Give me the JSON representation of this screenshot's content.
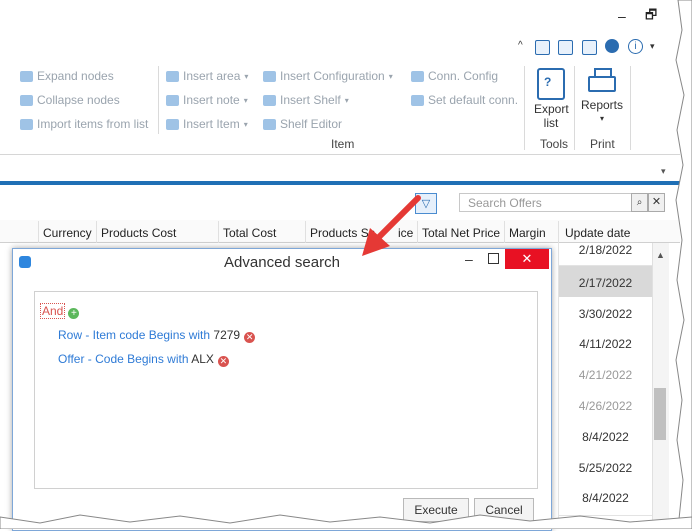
{
  "window": {
    "minimize": "–",
    "restore": "🗗"
  },
  "ribbon": {
    "nodes": [
      "Expand nodes",
      "Collapse nodes",
      "Import items from list"
    ],
    "insert": [
      "Insert area",
      "Insert note",
      "Insert Item"
    ],
    "config": [
      "Insert Configuration",
      "Insert Shelf",
      "Shelf Editor"
    ],
    "conn": [
      "Conn. Config",
      "Set default conn."
    ],
    "item_group": "Item",
    "export_label": "Export list",
    "tools_group": "Tools",
    "reports_label": "Reports",
    "print_group": "Print"
  },
  "search": {
    "placeholder": "Search Offers"
  },
  "grid": {
    "headers": [
      "Currency",
      "Products Cost",
      "Total Cost",
      "Products Sa",
      "ice",
      "Total Net Price",
      "Margin",
      "Update date"
    ],
    "dates": [
      "2/18/2022",
      "2/17/2022",
      "3/30/2022",
      "4/11/2022",
      "4/21/2022",
      "4/26/2022",
      "8/4/2022",
      "5/25/2022",
      "8/4/2022"
    ]
  },
  "dialog": {
    "title": "Advanced search",
    "operator": "And",
    "conditions": [
      {
        "field": "Row - Item code Begins with",
        "value": "7279"
      },
      {
        "field": "Offer - Code Begins with",
        "value": "ALX"
      }
    ],
    "execute": "Execute",
    "cancel": "Cancel"
  }
}
